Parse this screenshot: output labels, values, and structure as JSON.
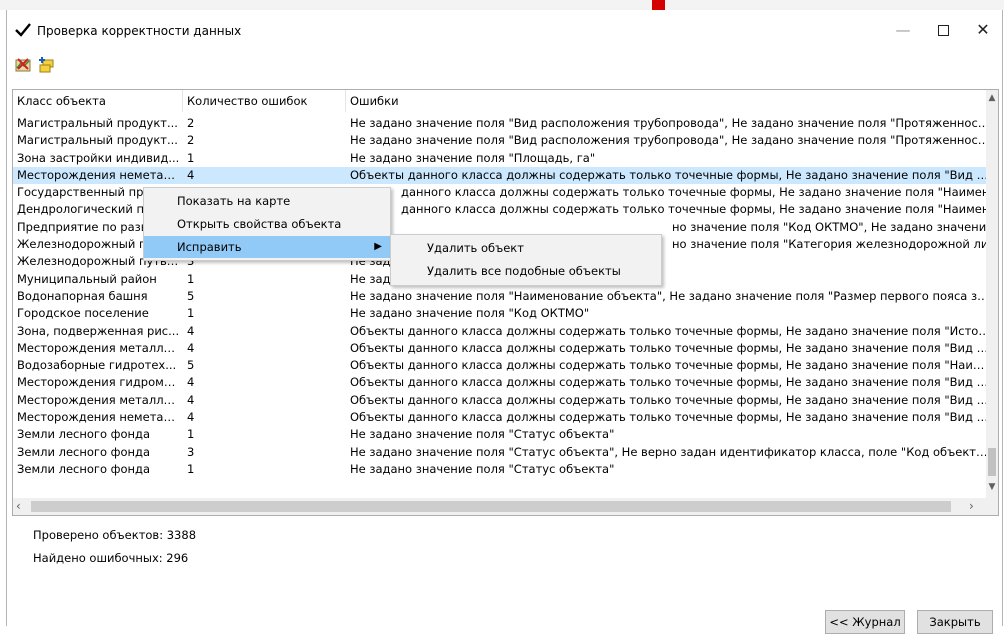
{
  "window": {
    "title": "Проверка корректности данных",
    "accent": "#0078d7"
  },
  "toolbar": {
    "icons": [
      "map-error-icon",
      "add-layer-icon"
    ]
  },
  "columns": [
    "Класс объекта",
    "Количество ошибок",
    "Ошибки"
  ],
  "rows": [
    {
      "cls": "Магистральный продукт...",
      "count": "2",
      "err": "Не задано значение поля \"Вид расположения трубопровода\", Не задано значение поля \"Протяженность сооружени..."
    },
    {
      "cls": "Магистральный продукт...",
      "count": "2",
      "err": "Не задано значение поля \"Вид расположения трубопровода\", Не задано значение поля \"Протяженность сооружени..."
    },
    {
      "cls": "Зона застройки индивид...",
      "count": "1",
      "err": "Не задано значение поля \"Площадь, га\""
    },
    {
      "cls": "Месторождения неметал...",
      "count": "4",
      "err": "Объекты данного класса должны содержать только точечные формы, Не задано значение поля \"Вид полезных ис..."
    },
    {
      "cls": "Государственный при",
      "count": "",
      "err": "данного класса должны содержать только точечные формы, Не задано значение поля \"Наименование об..."
    },
    {
      "cls": "Дендрологический па",
      "count": "",
      "err": "данного класса должны содержать только точечные формы, Не задано значение поля \"Наименование об..."
    },
    {
      "cls": "Предприятие по разв",
      "count": "",
      "err": "но значение поля \"Код ОКТМО\", Не задано значение по..."
    },
    {
      "cls": "Железнодорожный пу",
      "count": "",
      "err": "но значение поля \"Категория железнодорожной линии\"..."
    },
    {
      "cls": "Железнодорожный путь ...",
      "count": "3",
      "err": "Не задан"
    },
    {
      "cls": "Муниципальный район",
      "count": "1",
      "err": "Не задано значение поля \"Код ОКТМО\""
    },
    {
      "cls": "Водонапорная башня",
      "count": "5",
      "err": "Не задано значение поля \"Наименование объекта\", Не задано значение поля \"Размер первого пояса зоны санитарн..."
    },
    {
      "cls": "Городское поселение",
      "count": "1",
      "err": "Не задано значение поля \"Код ОКТМО\""
    },
    {
      "cls": "Зона, подверженная рис...",
      "count": "4",
      "err": "Объекты данного класса должны содержать только точечные формы, Не задано значение поля \"Источник техног..."
    },
    {
      "cls": "Месторождения металли...",
      "count": "4",
      "err": "Объекты данного класса должны содержать только точечные формы, Не задано значение поля \"Вид полезных ис..."
    },
    {
      "cls": "Водозаборные гидротех...",
      "count": "5",
      "err": "Объекты данного класса должны содержать только точечные формы, Не задано значение поля \"Наименование об..."
    },
    {
      "cls": "Месторождения гидроми...",
      "count": "4",
      "err": "Объекты данного класса должны содержать только точечные формы, Не задано значение поля \"Вид полезных ис..."
    },
    {
      "cls": "Месторождения металли...",
      "count": "4",
      "err": "Объекты данного класса должны содержать только точечные формы, Не задано значение поля \"Вид полезных ис..."
    },
    {
      "cls": "Месторождения неметал...",
      "count": "4",
      "err": "Объекты данного класса должны содержать только точечные формы, Не задано значение поля \"Вид полезных ис..."
    },
    {
      "cls": "Земли лесного фонда",
      "count": "1",
      "err": "Не задано значение поля \"Статус объекта\""
    },
    {
      "cls": "Земли лесного фонда",
      "count": "3",
      "err": "Не задано значение поля \"Статус объекта\", Не верно задан идентификатор класса, поле \"Код объекта\", Не задан..."
    },
    {
      "cls": "Земли лесного фонда",
      "count": "1",
      "err": "Не задано значение поля \"Статус объекта\""
    }
  ],
  "context_menu": {
    "items": [
      "Показать на карте",
      "Открыть свойства объекта",
      "Исправить"
    ],
    "submenu": [
      "Удалить объект",
      "Удалить все подобные объекты"
    ]
  },
  "stats": {
    "checked": "Проверено объектов: 3388",
    "found": "Найдено ошибочных: 296"
  },
  "buttons": {
    "journal": "<< Журнал",
    "close": "Закрыть"
  }
}
